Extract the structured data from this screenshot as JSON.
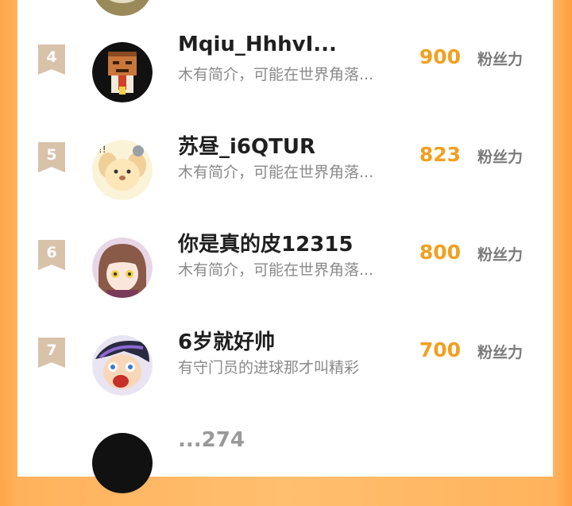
{
  "leaderboard": {
    "rows": [
      {
        "rank": "4",
        "name": "Mqiu_HhhvI...",
        "bio": "木有简介，可能在世界角落...",
        "count": "900",
        "unit": "粉丝力",
        "avatar_icon": "box-head-avatar"
      },
      {
        "rank": "5",
        "name": "苏昼_i6QTUR",
        "bio": "木有简介，可能在世界角落...",
        "count": "823",
        "unit": "粉丝力",
        "avatar_icon": "puppy-avatar"
      },
      {
        "rank": "6",
        "name": "你是真的皮12315",
        "bio": "木有简介，可能在世界角落...",
        "count": "800",
        "unit": "粉丝力",
        "avatar_icon": "anime-girl-avatar"
      },
      {
        "rank": "7",
        "name": "6岁就好帅",
        "bio": "有守门员的进球那才叫精彩",
        "count": "700",
        "unit": "粉丝力",
        "avatar_icon": "shocked-anime-avatar"
      },
      {
        "rank": "",
        "name": "...274",
        "bio": "",
        "count": "",
        "unit": "",
        "avatar_icon": "dark-avatar"
      }
    ]
  },
  "colors": {
    "accent": "#f0a020",
    "background": "#ffb25c",
    "rank_badge": "#d8c2aa"
  }
}
